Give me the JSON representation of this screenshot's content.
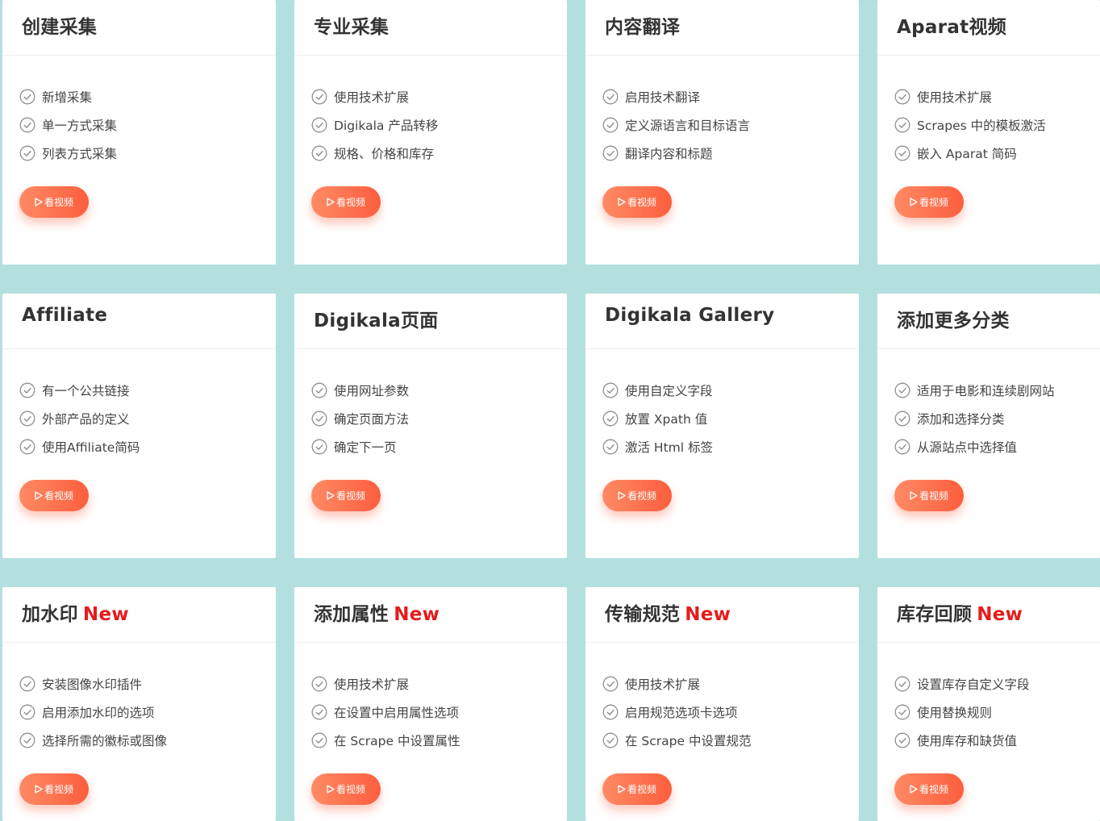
{
  "colors": {
    "page_background": "#b3e0df",
    "card_background": "#ffffff",
    "title": "#333333",
    "new_tag": "#e31d1d",
    "button_start": "#ff8a65",
    "button_end": "#fc5e3d"
  },
  "button_label": "看视频",
  "cards": [
    {
      "title": "创建采集",
      "new": "",
      "features": [
        "新增采集",
        "单一方式采集",
        "列表方式采集"
      ]
    },
    {
      "title": "专业采集",
      "new": "",
      "features": [
        "使用技术扩展",
        "Digikala 产品转移",
        "规格、价格和库存"
      ]
    },
    {
      "title": "内容翻译",
      "new": "",
      "features": [
        "启用技术翻译",
        "定义源语言和目标语言",
        "翻译内容和标题"
      ]
    },
    {
      "title": "Aparat视频",
      "new": "",
      "features": [
        "使用技术扩展",
        "Scrapes 中的模板激活",
        "嵌入 Aparat 简码"
      ]
    },
    {
      "title": "Affiliate",
      "new": "",
      "features": [
        "有一个公共链接",
        "外部产品的定义",
        "使用Affiliate简码"
      ]
    },
    {
      "title": "Digikala页面",
      "new": "",
      "features": [
        "使用网址参数",
        "确定页面方法",
        "确定下一页"
      ]
    },
    {
      "title": "Digikala Gallery",
      "new": "",
      "features": [
        "使用自定义字段",
        "放置 Xpath 值",
        "激活 Html 标签"
      ]
    },
    {
      "title": "添加更多分类",
      "new": "",
      "features": [
        "适用于电影和连续剧网站",
        "添加和选择分类",
        "从源站点中选择值"
      ]
    },
    {
      "title": "加水印",
      "new": "New",
      "features": [
        "安装图像水印插件",
        "启用添加水印的选项",
        "选择所需的徽标或图像"
      ]
    },
    {
      "title": "添加属性",
      "new": "New",
      "features": [
        "使用技术扩展",
        "在设置中启用属性选项",
        "在 Scrape 中设置属性"
      ]
    },
    {
      "title": "传输规范",
      "new": "New",
      "features": [
        "使用技术扩展",
        "启用规范选项卡选项",
        "在 Scrape 中设置规范"
      ]
    },
    {
      "title": "库存回顾",
      "new": "New",
      "features": [
        "设置库存自定义字段",
        "使用替换规则",
        "使用库存和缺货值"
      ]
    }
  ]
}
